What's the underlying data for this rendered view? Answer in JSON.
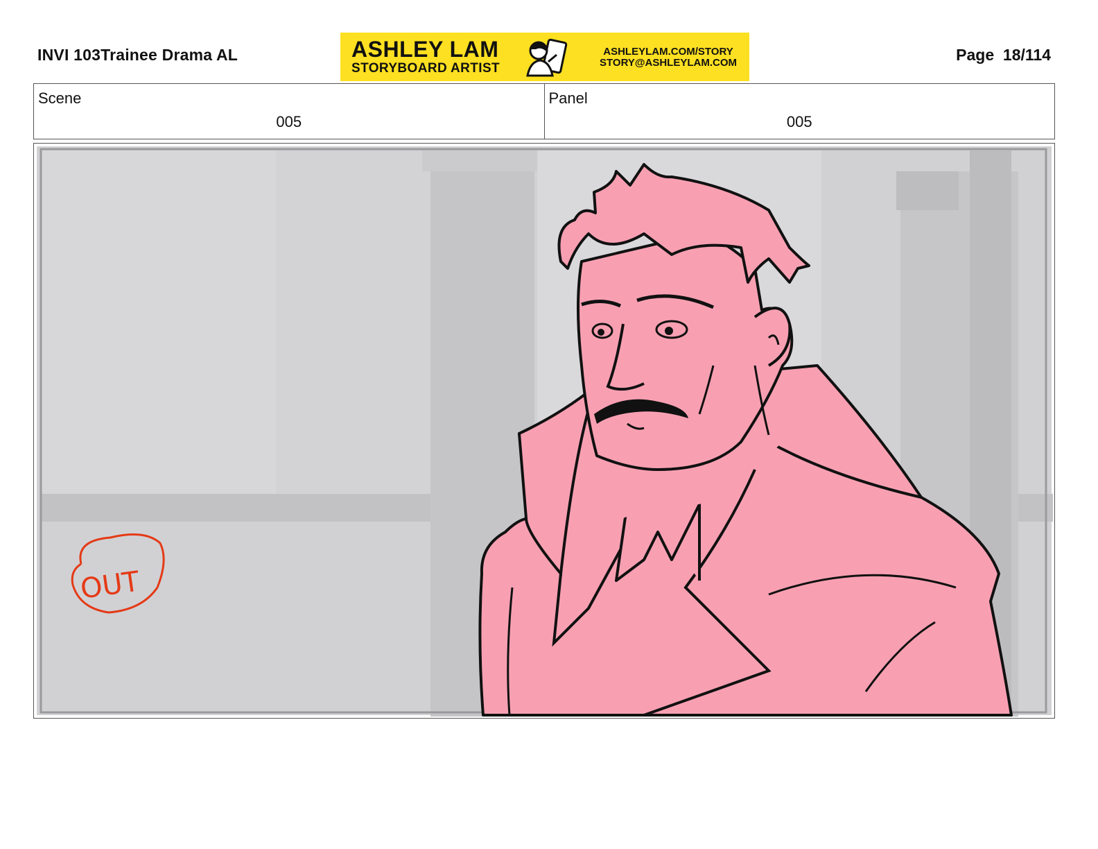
{
  "header": {
    "title": "INVI 103Trainee Drama AL",
    "page_label": "Page  18/114"
  },
  "banner": {
    "name": "ASHLEY LAM",
    "role": "STORYBOARD ARTIST",
    "site": "ASHLEYLAM.COM/STORY",
    "email": "STORY@ASHLEYLAM.COM",
    "background_color": "#fde021"
  },
  "info": {
    "scene_label": "Scene",
    "scene_value": "005",
    "panel_label": "Panel",
    "panel_value": "005"
  },
  "panel": {
    "annotation": "OUT",
    "annotation_color": "#e43a16",
    "character_fill": "#f8a0b2"
  }
}
